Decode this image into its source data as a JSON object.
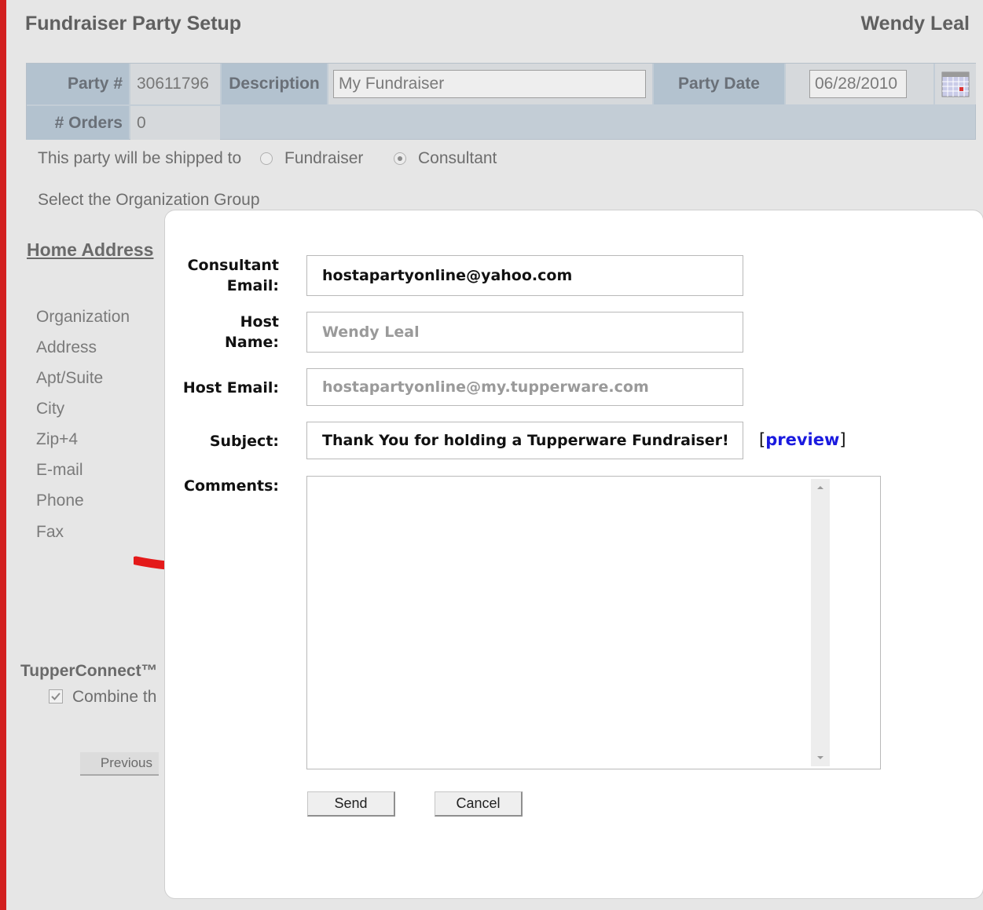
{
  "header": {
    "title": "Fundraiser Party Setup",
    "user_name": "Wendy Leal"
  },
  "party": {
    "party_number_label": "Party #",
    "party_number": "30611796",
    "description_label": "Description",
    "description_value": "My Fundraiser",
    "party_date_label": "Party Date",
    "party_date_value": "06/28/2010",
    "orders_label": "# Orders",
    "orders_value": "0"
  },
  "shipping": {
    "label": "This party will be shipped to",
    "options": [
      "Fundraiser",
      "Consultant"
    ],
    "selected": "Consultant"
  },
  "org_group_label": "Select the Organization Group",
  "home_address": {
    "heading": "Home Address",
    "fields": [
      "Organization",
      "Address",
      "Apt/Suite",
      "City",
      "Zip+4",
      "E-mail",
      "Phone",
      "Fax"
    ]
  },
  "tupperconnect": {
    "heading": "TupperConnect™",
    "checkbox_label": "Combine th",
    "checked": true
  },
  "previous_button": "Previous",
  "modal": {
    "consultant_email_label_1": "Consultant",
    "consultant_email_label_2": "Email:",
    "consultant_email": "hostapartyonline@yahoo.com",
    "host_name_label_1": "Host",
    "host_name_label_2": "Name:",
    "host_name": "Wendy Leal",
    "host_email_label": "Host Email:",
    "host_email": "hostapartyonline@my.tupperware.com",
    "subject_label": "Subject:",
    "subject": "Thank You for holding a Tupperware Fundraiser!",
    "preview_open": "[",
    "preview_link": "preview",
    "preview_close": "]",
    "comments_label": "Comments:",
    "comments": "",
    "send_button": "Send",
    "cancel_button": "Cancel"
  },
  "colors": {
    "arrow": "#e41a1a",
    "border_accent": "#d21f1f",
    "link": "#1a1adf"
  },
  "icons": [
    "calendar-icon",
    "scroll-up-icon",
    "scroll-down-icon",
    "checkbox-check-icon"
  ]
}
